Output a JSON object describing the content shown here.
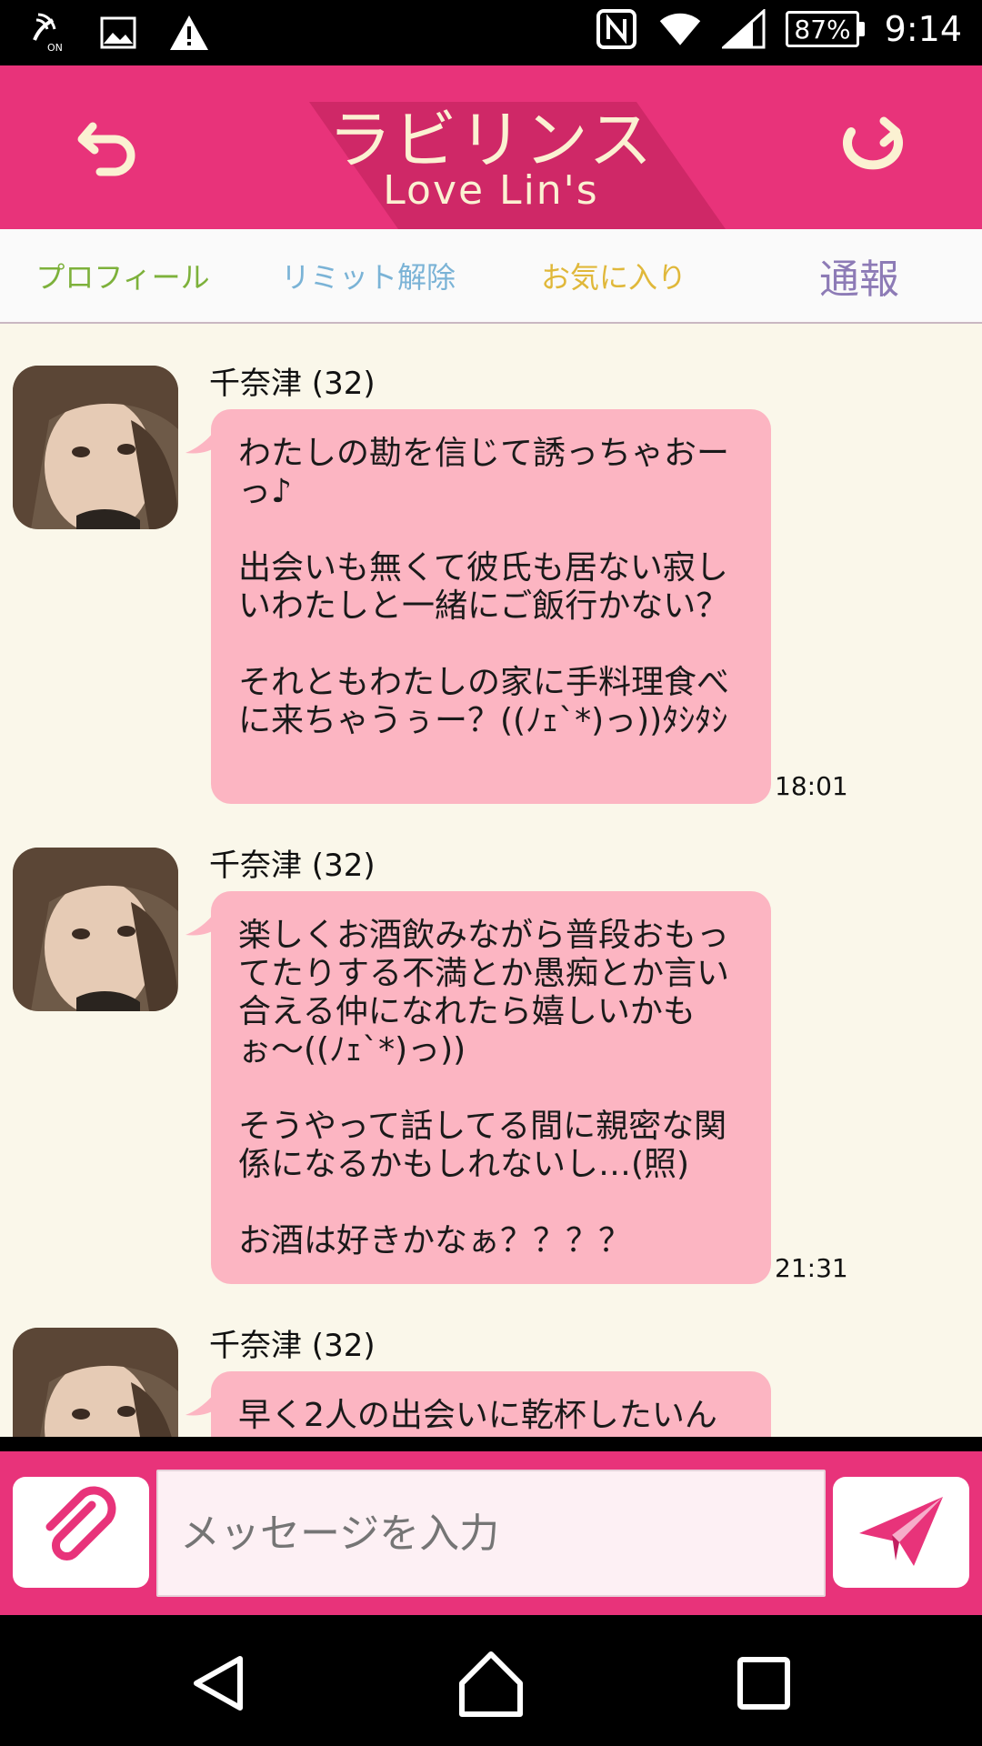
{
  "status_bar": {
    "battery": "87%",
    "time": "9:14",
    "icons": [
      "wifi-calling-icon",
      "image-icon",
      "warning-icon",
      "nfc-icon",
      "wifi-icon",
      "signal-icon",
      "battery-icon"
    ]
  },
  "header": {
    "title": "ラビリンス",
    "subtitle": "Love Lin's",
    "bg_color": "#e8337a",
    "title_color": "#fbf1d2",
    "back_icon": "undo-arrow-icon",
    "refresh_icon": "refresh-icon"
  },
  "tabs": [
    {
      "label": "プロフィール",
      "color": "#7db13b"
    },
    {
      "label": "リミット解除",
      "color": "#7ab3d6"
    },
    {
      "label": "お気に入り",
      "color": "#e0b83a"
    },
    {
      "label": "通報",
      "color": "#8d7bb6"
    }
  ],
  "messages": [
    {
      "sender": "千奈津 (32)",
      "text": "わたしの勘を信じて誘っちゃおーっ♪\n\n出会いも無くて彼氏も居ない寂しいわたしと一緒にご飯行かない？\n\nそれともわたしの家に手料理食べに来ちゃうぅー？((ﾉｪ`*)っ))ﾀｼﾀｼ",
      "time": "18:01"
    },
    {
      "sender": "千奈津 (32)",
      "text": "楽しくお酒飲みながら普段おもってたりする不満とか愚痴とか言い合える仲になれたら嬉しいかもぉ〜((ﾉｪ`*)っ))\n\nそうやって話してる間に親密な関係になるかもしれないし…(照)\n\nお酒は好きかなぁ？？？？",
      "time": "21:31"
    },
    {
      "sender": "千奈津 (32)",
      "text": "早く2人の出会いに乾杯したいん",
      "time": ""
    }
  ],
  "input": {
    "placeholder": "メッセージを入力",
    "attach_icon": "paperclip-icon",
    "send_icon": "paper-plane-icon"
  },
  "nav": {
    "back_icon": "back-triangle-icon",
    "home_icon": "home-icon",
    "recents_icon": "recents-square-icon"
  },
  "colors": {
    "chat_bg": "#faf7ea",
    "bubble": "#fcb5c2",
    "accent": "#e8337a"
  }
}
